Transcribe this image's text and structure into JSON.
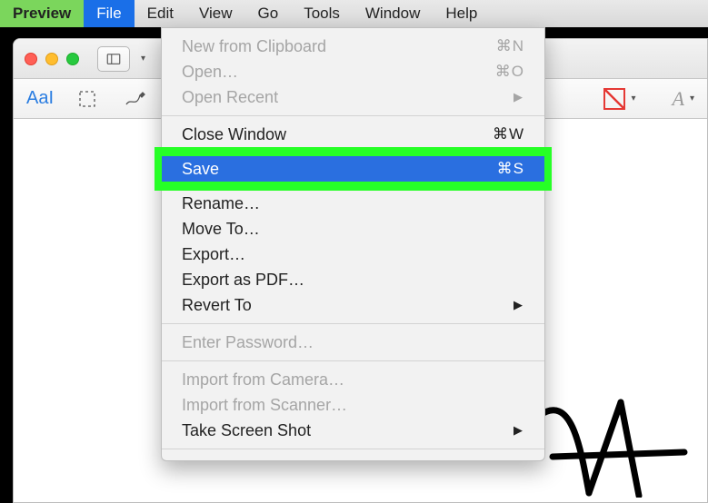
{
  "menubar": {
    "app": "Preview",
    "items": [
      "File",
      "Edit",
      "View",
      "Go",
      "Tools",
      "Window",
      "Help"
    ],
    "activeIndex": 0
  },
  "toolbar2": {
    "textTool": "AaI"
  },
  "fileMenu": {
    "group1": [
      {
        "label": "New from Clipboard",
        "shortcut": "⌘N",
        "disabled": true
      },
      {
        "label": "Open…",
        "shortcut": "⌘O",
        "disabled": true
      },
      {
        "label": "Open Recent",
        "submenu": true,
        "disabled": true
      }
    ],
    "group2a": [
      {
        "label": "Close Window",
        "shortcut": "⌘W"
      }
    ],
    "highlighted": {
      "label": "Save",
      "shortcut": "⌘S"
    },
    "group2b": [
      {
        "label": "Rename…"
      },
      {
        "label": "Move To…"
      },
      {
        "label": "Export…"
      },
      {
        "label": "Export as PDF…"
      },
      {
        "label": "Revert To",
        "submenu": true
      }
    ],
    "group3": [
      {
        "label": "Enter Password…",
        "disabled": true
      }
    ],
    "group4": [
      {
        "label": "Import from Camera…",
        "disabled": true
      },
      {
        "label": "Import from Scanner…",
        "disabled": true
      },
      {
        "label": "Take Screen Shot",
        "submenu": true
      }
    ]
  }
}
